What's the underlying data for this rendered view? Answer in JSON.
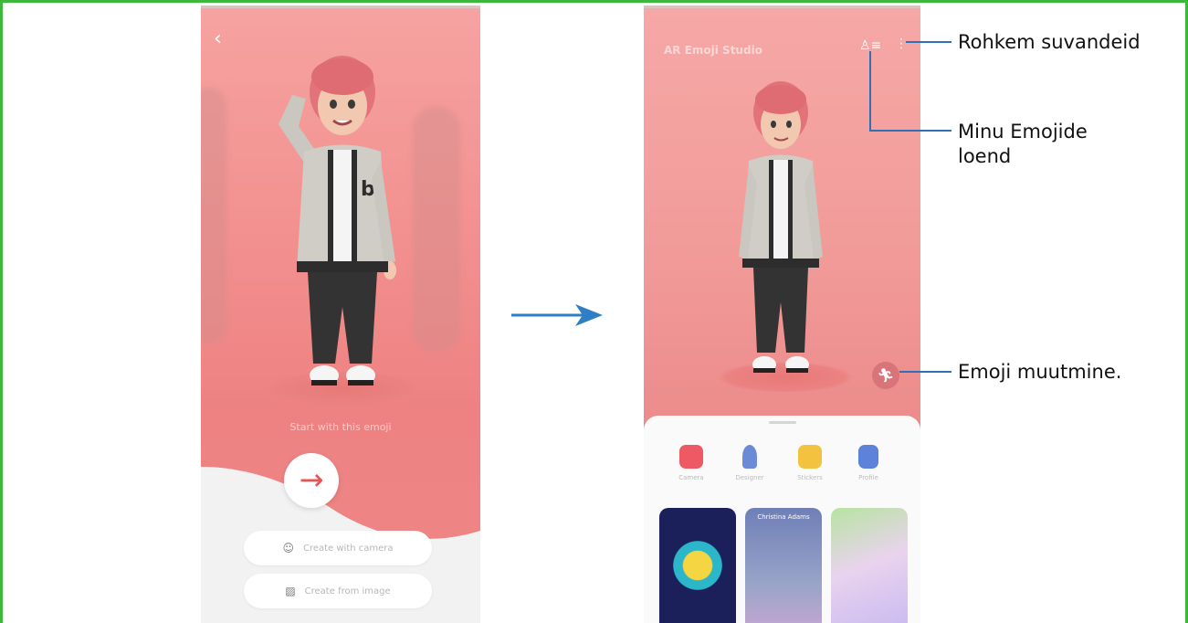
{
  "left_screen": {
    "back_glyph": "‹",
    "start_text": "Start with this emoji",
    "next_glyph": "→",
    "buttons": [
      {
        "label": "Create with camera",
        "icon": "face-icon"
      },
      {
        "label": "Create from image",
        "icon": "image-icon"
      }
    ]
  },
  "right_screen": {
    "title": "AR Emoji Studio",
    "features": [
      {
        "label": "Camera",
        "color": "#ee5a64"
      },
      {
        "label": "Designer",
        "color": "#6b8bd6"
      },
      {
        "label": "Stickers",
        "color": "#f3c340"
      },
      {
        "label": "Profile",
        "color": "#5c83d9"
      }
    ],
    "cards": [
      {
        "name": ""
      },
      {
        "name": "Christina Adams"
      },
      {
        "name": ""
      }
    ]
  },
  "callouts": {
    "more_options": "Rohkem suvandeid",
    "my_emoji_list_line1": "Minu Emojide",
    "my_emoji_list_line2": "loend",
    "edit_emoji": "Emoji muutmine."
  },
  "colors": {
    "frame": "#3cb93c",
    "arrow": "#2f7fc4",
    "callout_line": "#2f6fb5"
  }
}
